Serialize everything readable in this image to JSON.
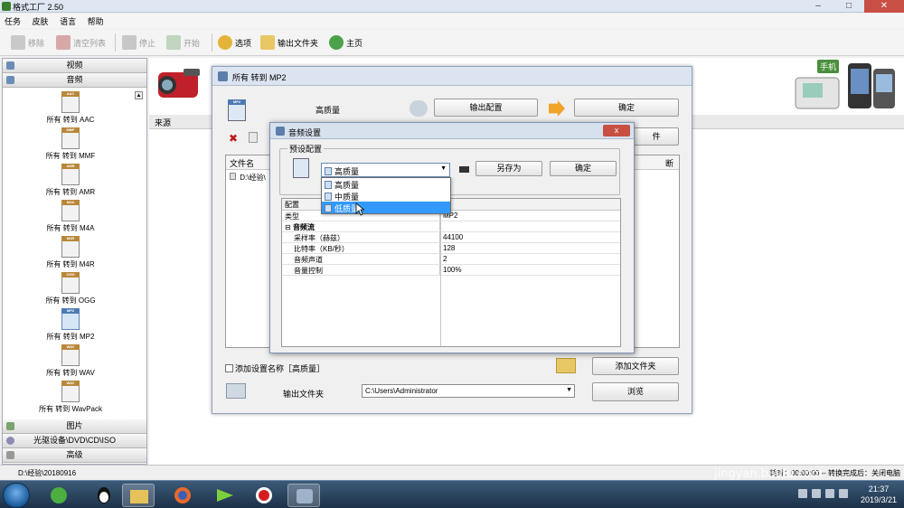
{
  "window": {
    "title": "格式工厂 2.50"
  },
  "menu": [
    "任务",
    "皮肤",
    "语言",
    "帮助"
  ],
  "toolbar": {
    "remove": "移除",
    "clear_list": "清空列表",
    "stop": "停止",
    "start": "开始",
    "options": "选项",
    "output_folder": "输出文件夹",
    "home": "主页"
  },
  "left_panel": {
    "categories_top": [
      "视频",
      "音频"
    ],
    "audio_items": [
      {
        "badge": "AAC",
        "label": "所有 转到 AAC"
      },
      {
        "badge": "MMF",
        "label": "所有 转到 MMF"
      },
      {
        "badge": "AMR",
        "label": "所有 转到 AMR"
      },
      {
        "badge": "M4A",
        "label": "所有 转到 M4A"
      },
      {
        "badge": "M4R",
        "label": "所有 转到 M4R"
      },
      {
        "badge": "OGG",
        "label": "所有 转到 OGG"
      },
      {
        "badge": "MP2",
        "label": "所有 转到 MP2"
      },
      {
        "badge": "WAV",
        "label": "所有 转到 WAV"
      },
      {
        "badge": "WAV",
        "label": "所有 转到 WavPack"
      }
    ],
    "categories_bottom": [
      "图片",
      "光驱设备\\DVD\\CD\\ISO",
      "高级"
    ]
  },
  "banner": {
    "phone_label": "手机"
  },
  "source_label": "来源",
  "status_bar": {
    "path": "D:\\经验\\20180916",
    "right_text": "耗时：00:00:00 -- 转换完成后：关闭电脑"
  },
  "mp2_dialog": {
    "title": "所有 转到 MP2",
    "icon_badge": "MP2",
    "quality_label": "高质量",
    "output_config_button": "输出配置",
    "ok_button": "确定",
    "add_file_partial": "件",
    "file_list": {
      "header_file": "文件名",
      "header_right": "断",
      "row": "D:\\经验\\"
    },
    "add_setting_name": "添加设置名称［高质量］",
    "add_file_button": "添加文件夹",
    "output_folder_label": "输出文件夹",
    "output_folder_value": "C:\\Users\\Administrator",
    "browse_button": "浏览"
  },
  "audio_dialog": {
    "title": "音频设置",
    "close": "x",
    "group_legend": "预设配置",
    "preset_selected": "高质量",
    "save_as_button": "另存为",
    "ok_button": "确定",
    "dropdown_options": [
      "高质量",
      "中质量",
      "低质量"
    ],
    "grid": {
      "header_left": "配置",
      "header_right": "值",
      "rows": [
        {
          "name": "类型",
          "value": "MP2",
          "indent": 0
        },
        {
          "name": "音频流",
          "value": "",
          "indent": 1
        },
        {
          "name": "采样率（赫兹）",
          "value": "44100",
          "indent": 2
        },
        {
          "name": "比特率（KB/秒）",
          "value": "128",
          "indent": 2
        },
        {
          "name": "音频声道",
          "value": "2",
          "indent": 2
        },
        {
          "name": "音量控制",
          "value": "100%",
          "indent": 2
        }
      ]
    }
  },
  "taskbar": {
    "time": "21:37",
    "date": "2019/3/21"
  },
  "watermark": {
    "main": "Baidu经验",
    "sub": "jingyan.baidu.com"
  },
  "colors": {
    "highlight": "#3399ff",
    "close_red": "#c75043",
    "taskbar": "#1c3148"
  }
}
